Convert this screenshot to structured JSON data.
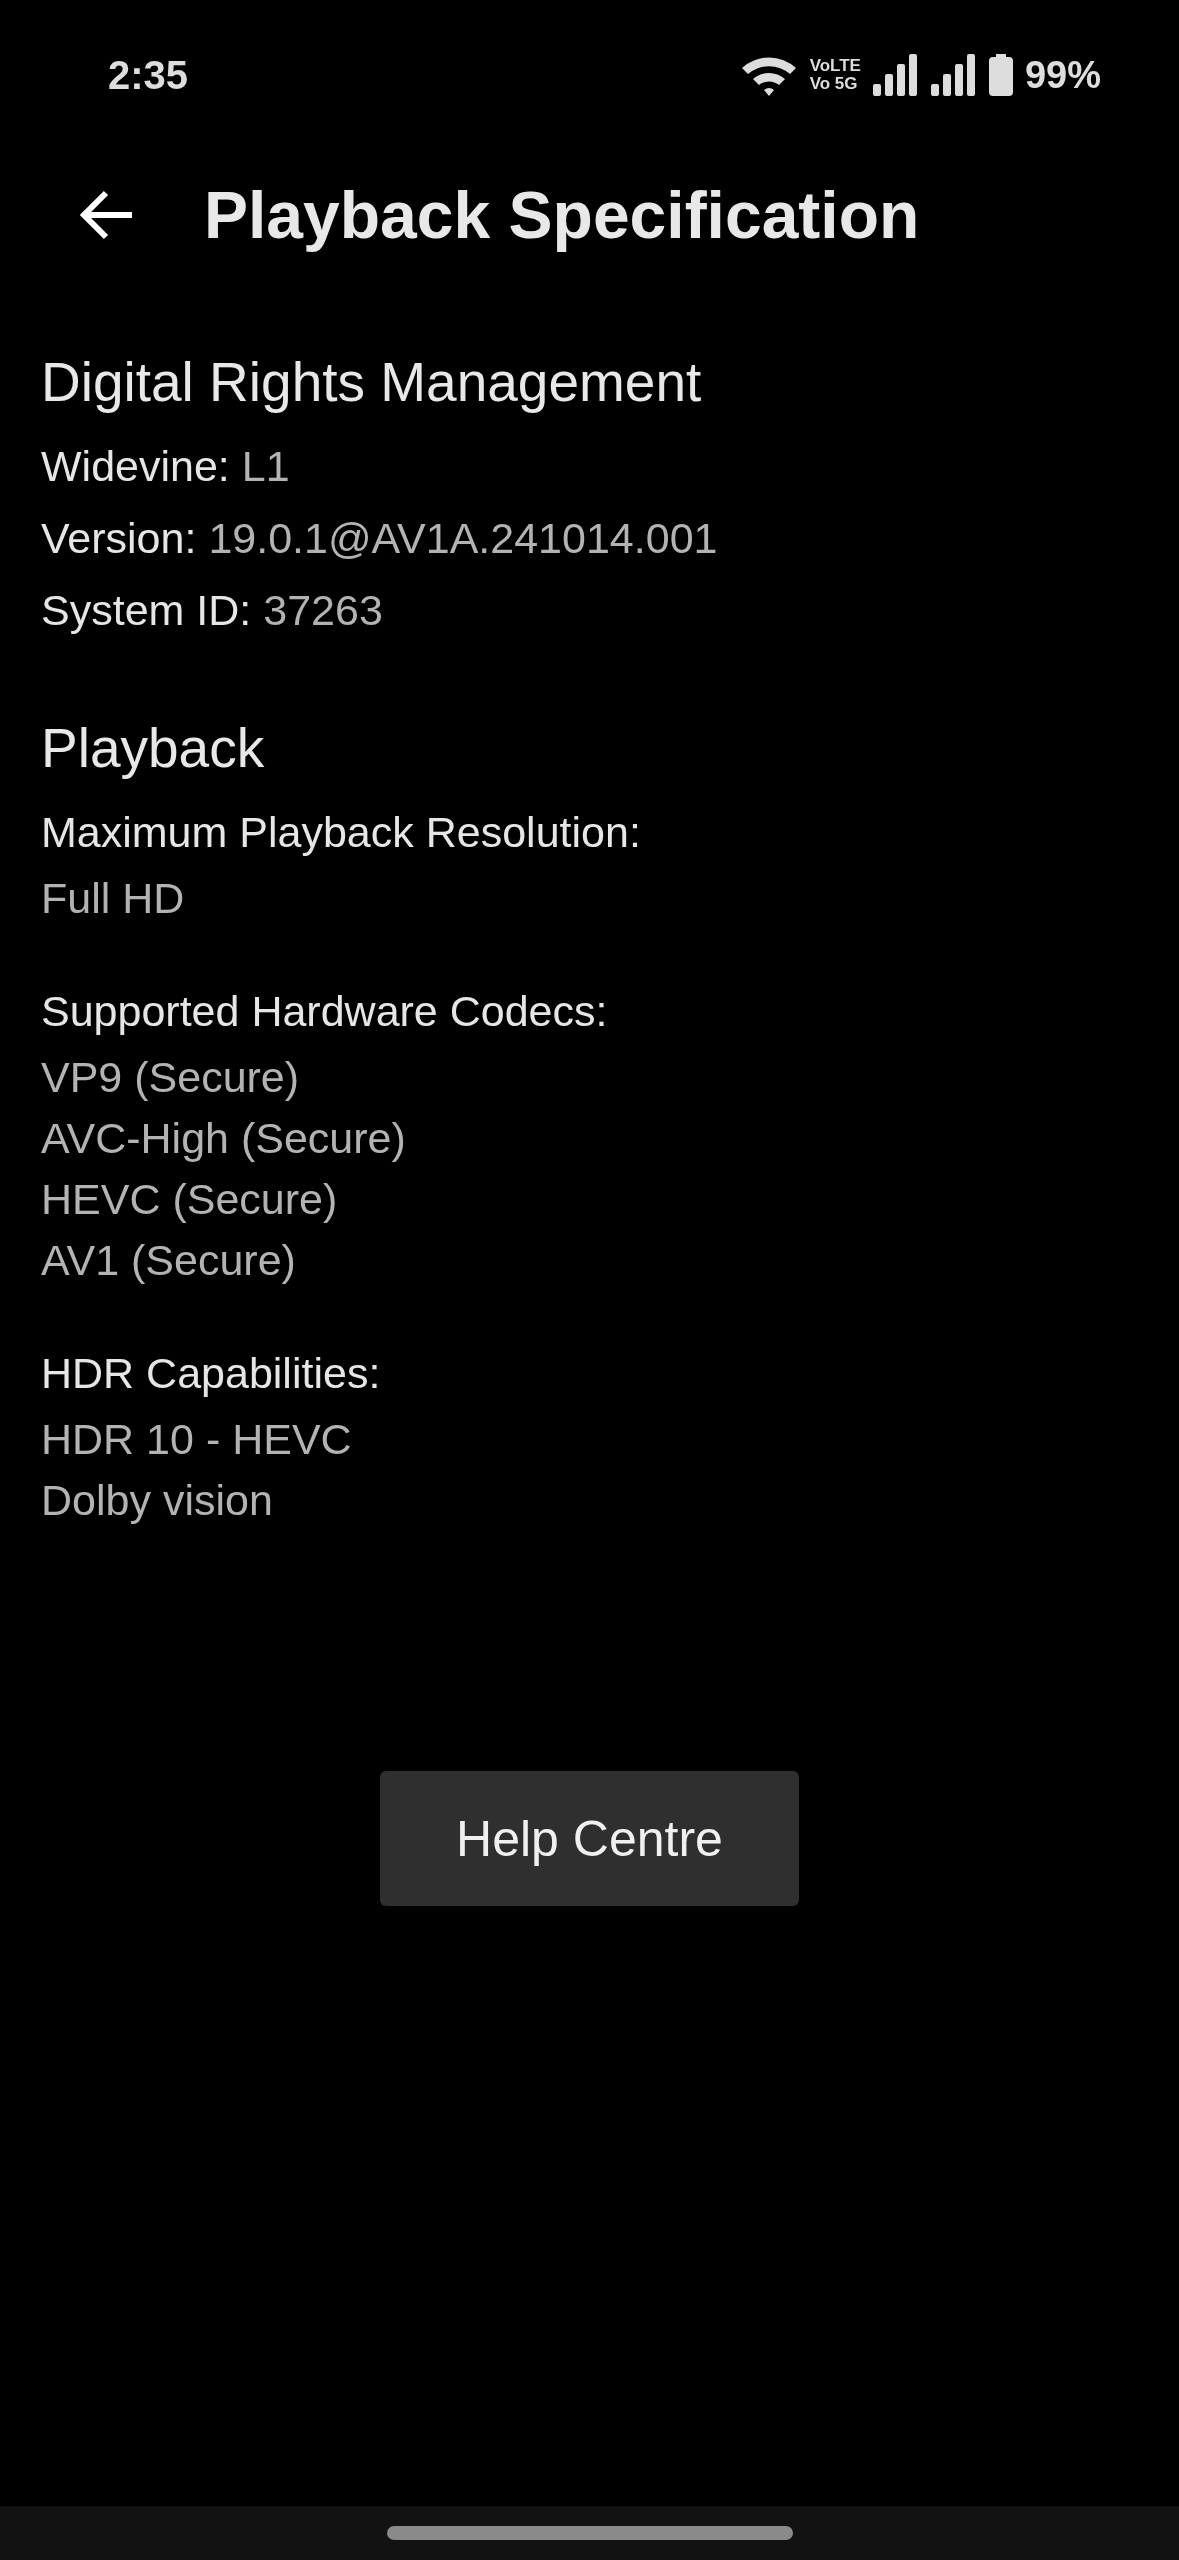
{
  "status_bar": {
    "time": "2:35",
    "network_top": "VoLTE",
    "network_bottom": "Vo 5G",
    "battery": "99%"
  },
  "header": {
    "title": "Playback Specification"
  },
  "sections": [
    {
      "title": "Digital Rights Management",
      "kind": "pairs",
      "items": [
        {
          "label": "Widevine:",
          "value": "L1"
        },
        {
          "label": "Version:",
          "value": "19.0.1@AV1A.241014.001"
        },
        {
          "label": "System ID:",
          "value": "37263"
        }
      ]
    },
    {
      "title": "Playback",
      "kind": "groups",
      "items": [
        {
          "label": "Maximum Playback Resolution:",
          "values": [
            "Full HD"
          ]
        },
        {
          "label": "Supported Hardware Codecs:",
          "values": [
            "VP9 (Secure)",
            "AVC-High (Secure)",
            "HEVC (Secure)",
            "AV1 (Secure)"
          ]
        },
        {
          "label": "HDR Capabilities:",
          "values": [
            "HDR 10 - HEVC",
            "Dolby vision"
          ]
        }
      ]
    }
  ],
  "button": {
    "label": "Help Centre"
  }
}
